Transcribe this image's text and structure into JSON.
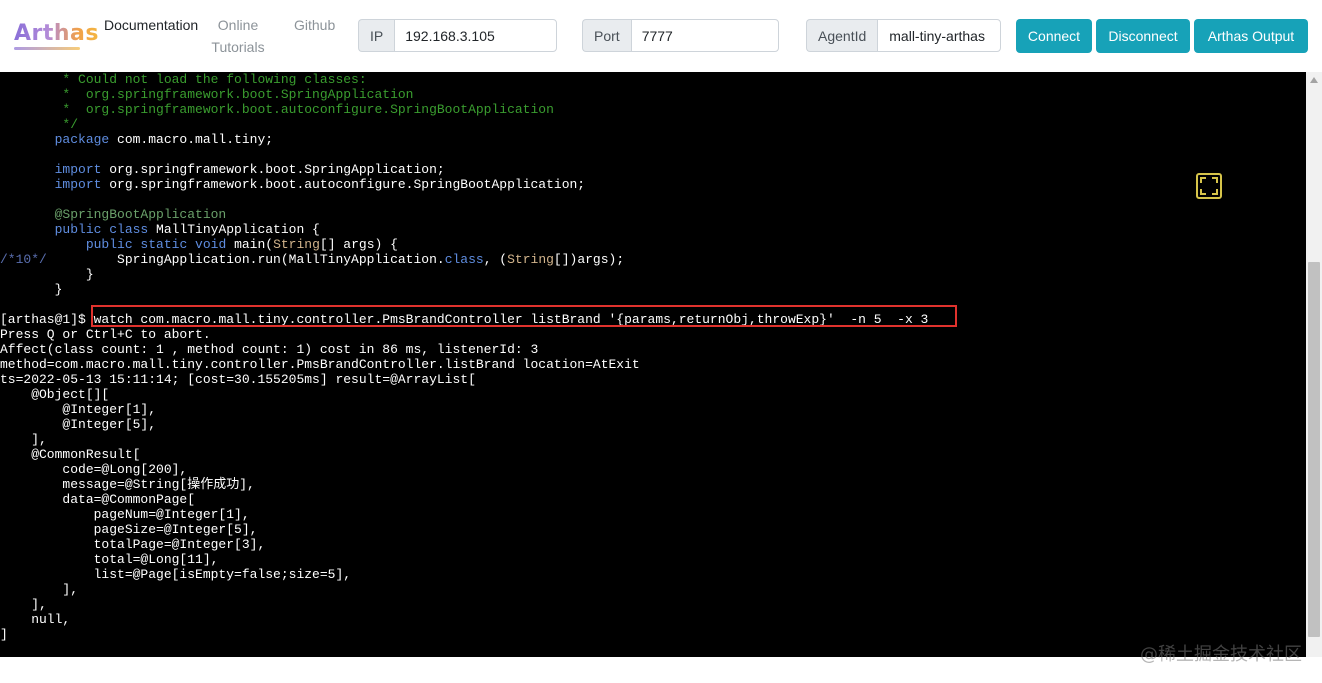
{
  "app": {
    "logo_text": "Arthas",
    "colors": {
      "accent": "#17a2b8",
      "terminal_bg": "#000000",
      "highlight_border": "#e0322d"
    }
  },
  "nav": {
    "documentation": "Documentation",
    "online_tutorials_line1": "Online",
    "online_tutorials_line2": "Tutorials",
    "github": "Github"
  },
  "connection": {
    "ip_label": "IP",
    "ip_value": "192.168.3.105",
    "port_label": "Port",
    "port_value": "7777",
    "agent_label": "AgentId",
    "agent_value": "mall-tiny-arthas"
  },
  "buttons": {
    "connect": "Connect",
    "disconnect": "Disconnect",
    "output": "Arthas Output"
  },
  "terminal": {
    "source_lines": [
      {
        "gutter": "",
        "segments": [
          {
            "t": "        * Could not load the following classes:",
            "c": "comment"
          }
        ]
      },
      {
        "gutter": "",
        "segments": [
          {
            "t": "        *  org.springframework.boot.SpringApplication",
            "c": "comment"
          }
        ]
      },
      {
        "gutter": "",
        "segments": [
          {
            "t": "        *  org.springframework.boot.autoconfigure.SpringBootApplication",
            "c": "comment"
          }
        ]
      },
      {
        "gutter": "",
        "segments": [
          {
            "t": "        */",
            "c": "comment"
          }
        ]
      },
      {
        "gutter": "",
        "segments": [
          {
            "t": "       ",
            "c": ""
          },
          {
            "t": "package",
            "c": "kw"
          },
          {
            "t": " com.macro.mall.tiny;",
            "c": ""
          }
        ]
      },
      {
        "gutter": "",
        "segments": [
          {
            "t": "",
            "c": ""
          }
        ]
      },
      {
        "gutter": "",
        "segments": [
          {
            "t": "       ",
            "c": ""
          },
          {
            "t": "import",
            "c": "kw"
          },
          {
            "t": " org.springframework.boot.SpringApplication;",
            "c": ""
          }
        ]
      },
      {
        "gutter": "",
        "segments": [
          {
            "t": "       ",
            "c": ""
          },
          {
            "t": "import",
            "c": "kw"
          },
          {
            "t": " org.springframework.boot.autoconfigure.SpringBootApplication;",
            "c": ""
          }
        ]
      },
      {
        "gutter": "",
        "segments": [
          {
            "t": "",
            "c": ""
          }
        ]
      },
      {
        "gutter": "",
        "segments": [
          {
            "t": "       ",
            "c": ""
          },
          {
            "t": "@SpringBootApplication",
            "c": "ann"
          }
        ]
      },
      {
        "gutter": "",
        "segments": [
          {
            "t": "       ",
            "c": ""
          },
          {
            "t": "public class",
            "c": "kw"
          },
          {
            "t": " MallTinyApplication {",
            "c": ""
          }
        ]
      },
      {
        "gutter": "",
        "segments": [
          {
            "t": "           ",
            "c": ""
          },
          {
            "t": "public static void",
            "c": "kw"
          },
          {
            "t": " main(",
            "c": ""
          },
          {
            "t": "String",
            "c": "type"
          },
          {
            "t": "[] args) {",
            "c": ""
          }
        ]
      },
      {
        "gutter": "/*10*/",
        "segments": [
          {
            "t": "/*10*/",
            "c": "linenum"
          },
          {
            "t": "         SpringApplication.run(MallTinyApplication.",
            "c": ""
          },
          {
            "t": "class",
            "c": "kw"
          },
          {
            "t": ", (",
            "c": ""
          },
          {
            "t": "String",
            "c": "type"
          },
          {
            "t": "[])args);",
            "c": ""
          }
        ]
      },
      {
        "gutter": "",
        "segments": [
          {
            "t": "           }",
            "c": ""
          }
        ]
      },
      {
        "gutter": "",
        "segments": [
          {
            "t": "       }",
            "c": ""
          }
        ]
      },
      {
        "gutter": "",
        "segments": [
          {
            "t": "",
            "c": ""
          }
        ]
      }
    ],
    "prompt": "[arthas@1]$ ",
    "command": "watch com.macro.mall.tiny.controller.PmsBrandController listBrand '{params,returnObj,throwExp}'  -n 5  -x 3",
    "output_lines": [
      "Press Q or Ctrl+C to abort.",
      "Affect(class count: 1 , method count: 1) cost in 86 ms, listenerId: 3",
      "method=com.macro.mall.tiny.controller.PmsBrandController.listBrand location=AtExit",
      "ts=2022-05-13 15:11:14; [cost=30.155205ms] result=@ArrayList[",
      "    @Object[][",
      "        @Integer[1],",
      "        @Integer[5],",
      "    ],",
      "    @CommonResult[",
      "        code=@Long[200],",
      "        message=@String[操作成功],",
      "        data=@CommonPage[",
      "            pageNum=@Integer[1],",
      "            pageSize=@Integer[5],",
      "            totalPage=@Integer[3],",
      "            total=@Long[11],",
      "            list=@Page[isEmpty=false;size=5],",
      "        ],",
      "    ],",
      "    null,",
      "]"
    ]
  },
  "watermark": "@稀土掘金技术社区"
}
